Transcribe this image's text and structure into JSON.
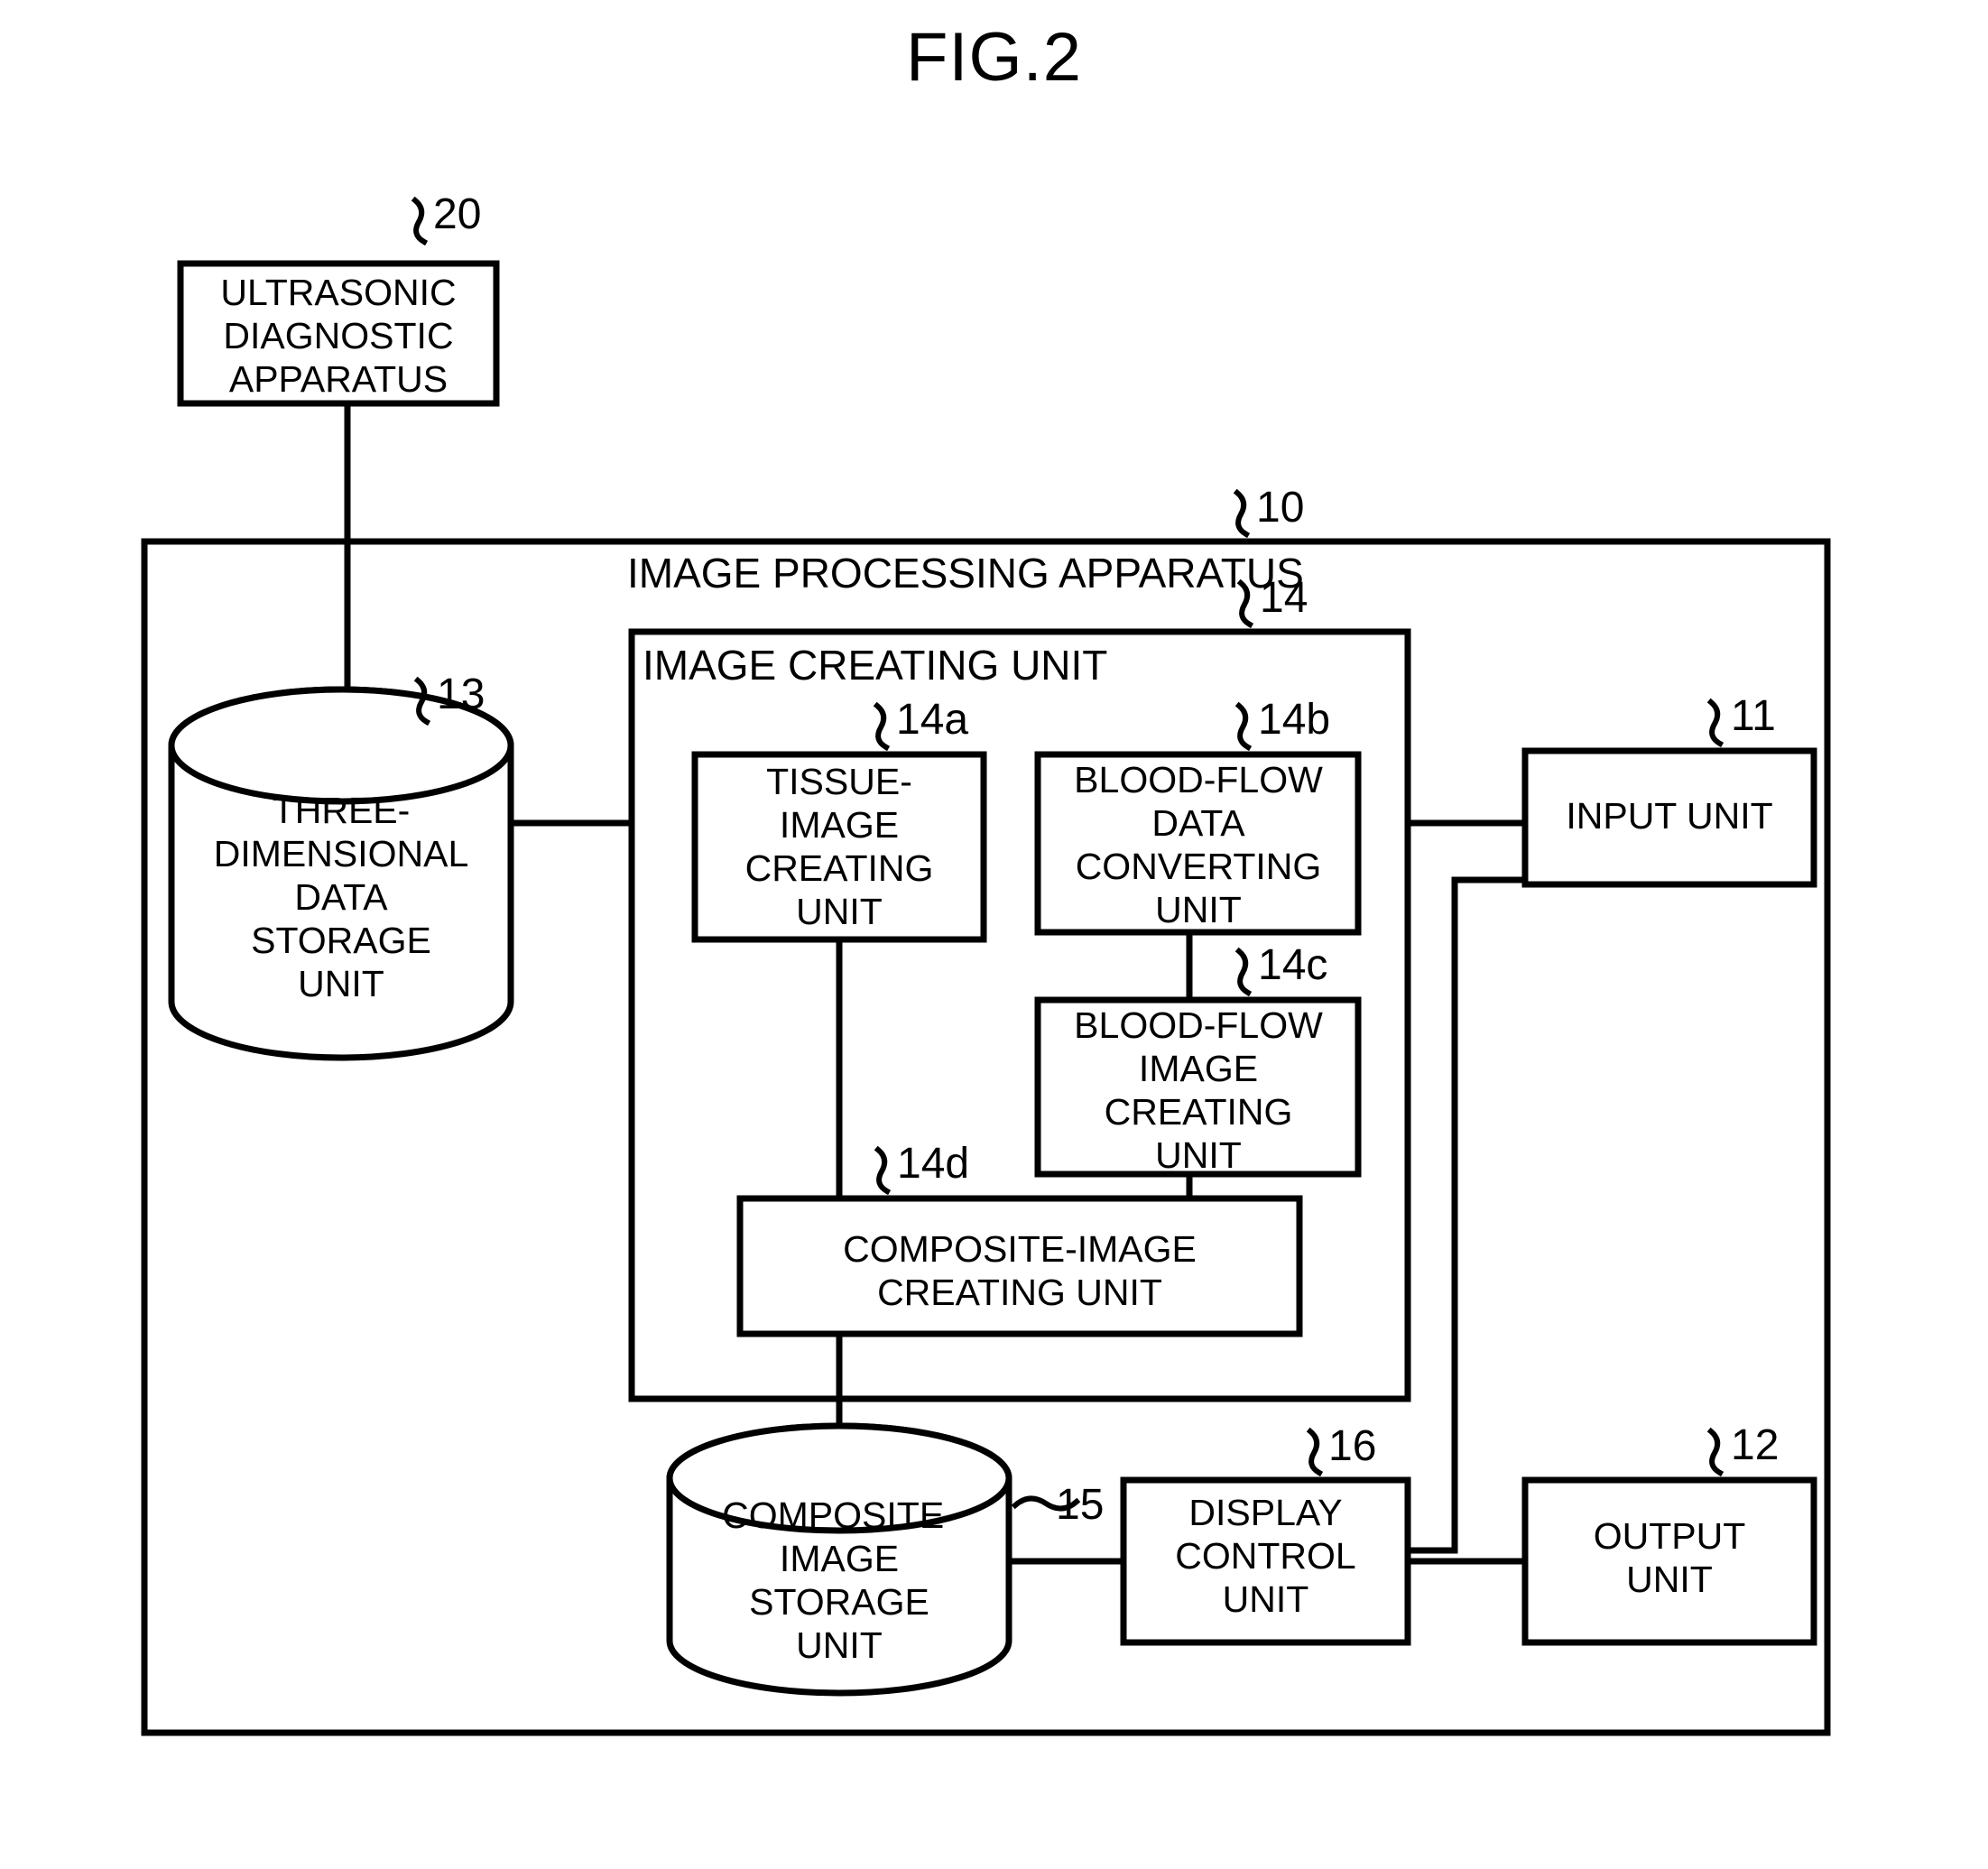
{
  "figure": {
    "title": "FIG.2"
  },
  "nodes": {
    "ultrasonic": {
      "label": "ULTRASONIC\nDIAGNOSTIC\nAPPARATUS",
      "ref": "20"
    },
    "image_processing_apparatus": {
      "label": "IMAGE PROCESSING APPARATUS",
      "ref": "10"
    },
    "three_dimensional_storage": {
      "label": "THREE-\nDIMENSIONAL\nDATA\nSTORAGE\nUNIT",
      "ref": "13"
    },
    "image_creating_unit": {
      "label": "IMAGE CREATING UNIT",
      "ref": "14"
    },
    "tissue_image_creating_unit": {
      "label": "TISSUE-\nIMAGE\nCREATING\nUNIT",
      "ref": "14a"
    },
    "blood_flow_data_converting_unit": {
      "label": "BLOOD-FLOW\nDATA\nCONVERTING\nUNIT",
      "ref": "14b"
    },
    "blood_flow_image_creating_unit": {
      "label": "BLOOD-FLOW\nIMAGE\nCREATING\nUNIT",
      "ref": "14c"
    },
    "composite_image_creating_unit": {
      "label": "COMPOSITE-IMAGE\nCREATING UNIT",
      "ref": "14d"
    },
    "composite_image_storage_unit": {
      "label": "COMPOSITE-\nIMAGE\nSTORAGE\nUNIT",
      "ref": "15"
    },
    "display_control_unit": {
      "label": "DISPLAY\nCONTROL\nUNIT",
      "ref": "16"
    },
    "input_unit": {
      "label": "INPUT UNIT",
      "ref": "11"
    },
    "output_unit": {
      "label": "OUTPUT\nUNIT",
      "ref": "12"
    }
  },
  "colors": {
    "stroke": "#000000",
    "background": "#ffffff"
  }
}
